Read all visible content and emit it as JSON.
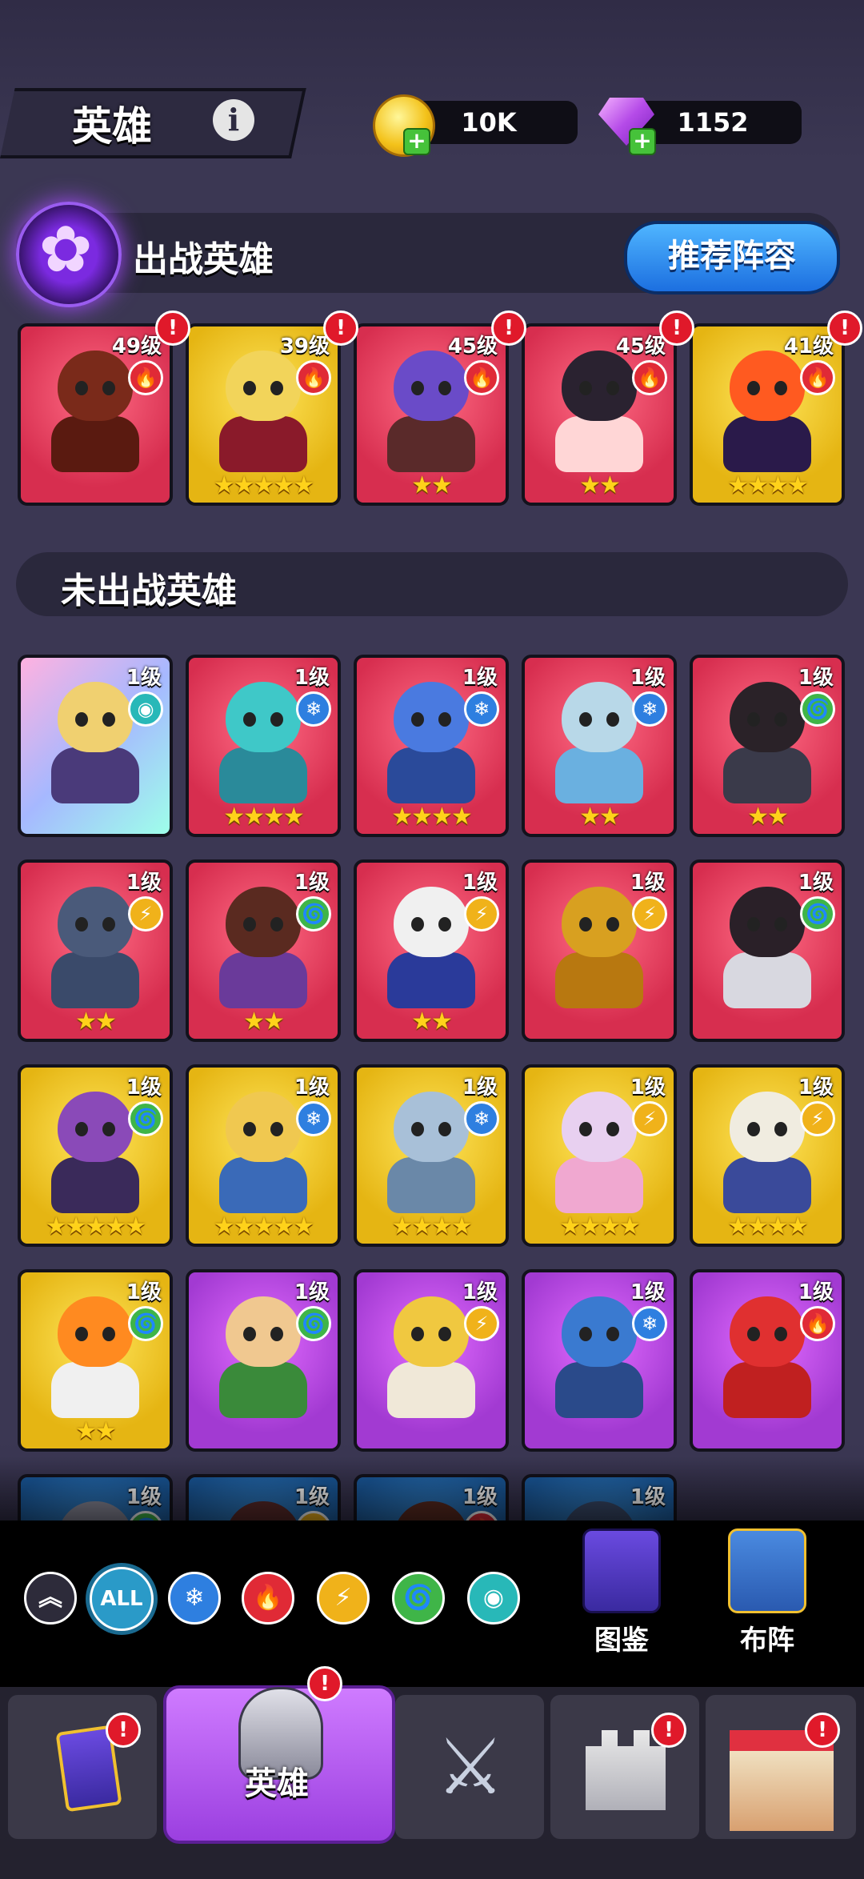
{
  "header": {
    "title": "英雄",
    "info_icon": "info-icon",
    "gold": "10K",
    "gems": "1152"
  },
  "deployed": {
    "title": "出战英雄",
    "recommend_button": "推荐阵容",
    "heroes": [
      {
        "level": "49级",
        "element": "fire",
        "stars": "",
        "bg": "red",
        "head": "#7a2a1a",
        "body": "#5a1a10",
        "alert": "!"
      },
      {
        "level": "39级",
        "element": "fire",
        "stars": "★★★★★",
        "bg": "gold",
        "head": "#f2d45a",
        "body": "#8a1a2a",
        "alert": "!"
      },
      {
        "level": "45级",
        "element": "fire",
        "stars": "★★",
        "bg": "red",
        "head": "#6a4bc8",
        "body": "#5a2a2a",
        "alert": "!"
      },
      {
        "level": "45级",
        "element": "fire",
        "stars": "★★",
        "bg": "red",
        "head": "#2a2230",
        "body": "#ffd6d6",
        "alert": "!"
      },
      {
        "level": "41级",
        "element": "fire",
        "stars": "★★★★",
        "bg": "gold",
        "head": "#ff5a20",
        "body": "#2a1a4a",
        "alert": "!"
      }
    ]
  },
  "undeployed": {
    "title": "未出战英雄",
    "heroes": [
      {
        "level": "1级",
        "element": "eye",
        "stars": "",
        "bg": "rainbow",
        "head": "#f0d070",
        "body": "#4a3a7a"
      },
      {
        "level": "1级",
        "element": "ice",
        "stars": "★★★★",
        "bg": "red",
        "head": "#3fc8c8",
        "body": "#2a8a9a"
      },
      {
        "level": "1级",
        "element": "ice",
        "stars": "★★★★",
        "bg": "red",
        "head": "#4a7ae0",
        "body": "#2a4a9a"
      },
      {
        "level": "1级",
        "element": "ice",
        "stars": "★★",
        "bg": "red",
        "head": "#b8d8e8",
        "body": "#6ab0e0"
      },
      {
        "level": "1级",
        "element": "wind",
        "stars": "★★",
        "bg": "red",
        "head": "#2a2228",
        "body": "#3a3a4a"
      },
      {
        "level": "1级",
        "element": "bolt",
        "stars": "★★",
        "bg": "red",
        "head": "#4a5a7a",
        "body": "#3a4a6a"
      },
      {
        "level": "1级",
        "element": "wind",
        "stars": "★★",
        "bg": "red",
        "head": "#5a2a20",
        "body": "#6a3a9a"
      },
      {
        "level": "1级",
        "element": "bolt",
        "stars": "★★",
        "bg": "red",
        "head": "#f0f0f0",
        "body": "#2a3a9a"
      },
      {
        "level": "1级",
        "element": "bolt",
        "stars": "",
        "bg": "red",
        "head": "#d8a020",
        "body": "#b87810"
      },
      {
        "level": "1级",
        "element": "wind",
        "stars": "",
        "bg": "red",
        "head": "#2a2028",
        "body": "#d8d8e0"
      },
      {
        "level": "1级",
        "element": "wind",
        "stars": "★★★★★",
        "bg": "gold",
        "head": "#8a4ab8",
        "body": "#3a2a5a"
      },
      {
        "level": "1级",
        "element": "ice",
        "stars": "★★★★★",
        "bg": "gold",
        "head": "#f0c850",
        "body": "#3a6ab8"
      },
      {
        "level": "1级",
        "element": "ice",
        "stars": "★★★★",
        "bg": "gold",
        "head": "#a8c0d8",
        "body": "#6a88a8"
      },
      {
        "level": "1级",
        "element": "bolt",
        "stars": "★★★★",
        "bg": "gold",
        "head": "#e8d0f0",
        "body": "#f0a8d0"
      },
      {
        "level": "1级",
        "element": "bolt",
        "stars": "★★★★",
        "bg": "gold",
        "head": "#f0ece0",
        "body": "#3a4a9a"
      },
      {
        "level": "1级",
        "element": "wind",
        "stars": "★★",
        "bg": "gold",
        "head": "#ff8a20",
        "body": "#f0f0f0"
      },
      {
        "level": "1级",
        "element": "wind",
        "stars": "",
        "bg": "purple",
        "head": "#f0c890",
        "body": "#3a8a3a"
      },
      {
        "level": "1级",
        "element": "bolt",
        "stars": "",
        "bg": "purple",
        "head": "#f0c840",
        "body": "#f0e8d8"
      },
      {
        "level": "1级",
        "element": "ice",
        "stars": "",
        "bg": "purple",
        "head": "#3a7ad0",
        "body": "#2a4a8a"
      },
      {
        "level": "1级",
        "element": "fire",
        "stars": "",
        "bg": "purple",
        "head": "#e03030",
        "body": "#c02020"
      },
      {
        "level": "1级",
        "element": "wind",
        "stars": "",
        "bg": "blue",
        "head": "#8a8a9a",
        "body": "#4a4a5a"
      },
      {
        "level": "1级",
        "element": "bolt",
        "stars": "",
        "bg": "blue",
        "head": "#5a2a2a",
        "body": "#3a2a2a"
      },
      {
        "level": "1级",
        "element": "fire",
        "stars": "",
        "bg": "blue",
        "head": "#5a2a20",
        "body": "#3a2a2a"
      },
      {
        "level": "1级",
        "element": "",
        "stars": "",
        "bg": "blue",
        "head": "#3a4a6a",
        "body": "#2a3a5a"
      }
    ]
  },
  "filters": [
    {
      "name": "collapse",
      "glyph": "︽",
      "color": "#2d2b3a"
    },
    {
      "name": "all",
      "glyph": "ALL",
      "color": "#2a9ac8"
    },
    {
      "name": "ice",
      "glyph": "❄",
      "color": "#2e7fe0"
    },
    {
      "name": "fire",
      "glyph": "🔥",
      "color": "#e02a36"
    },
    {
      "name": "bolt",
      "glyph": "⚡",
      "color": "#f0b21a"
    },
    {
      "name": "wind",
      "glyph": "🌀",
      "color": "#3fb548"
    },
    {
      "name": "eye",
      "glyph": "◉",
      "color": "#28b8b8"
    }
  ],
  "side_buttons": {
    "codex": "图鉴",
    "formation": "布阵"
  },
  "nav": {
    "heroes_label": "英雄",
    "alert": "!"
  }
}
